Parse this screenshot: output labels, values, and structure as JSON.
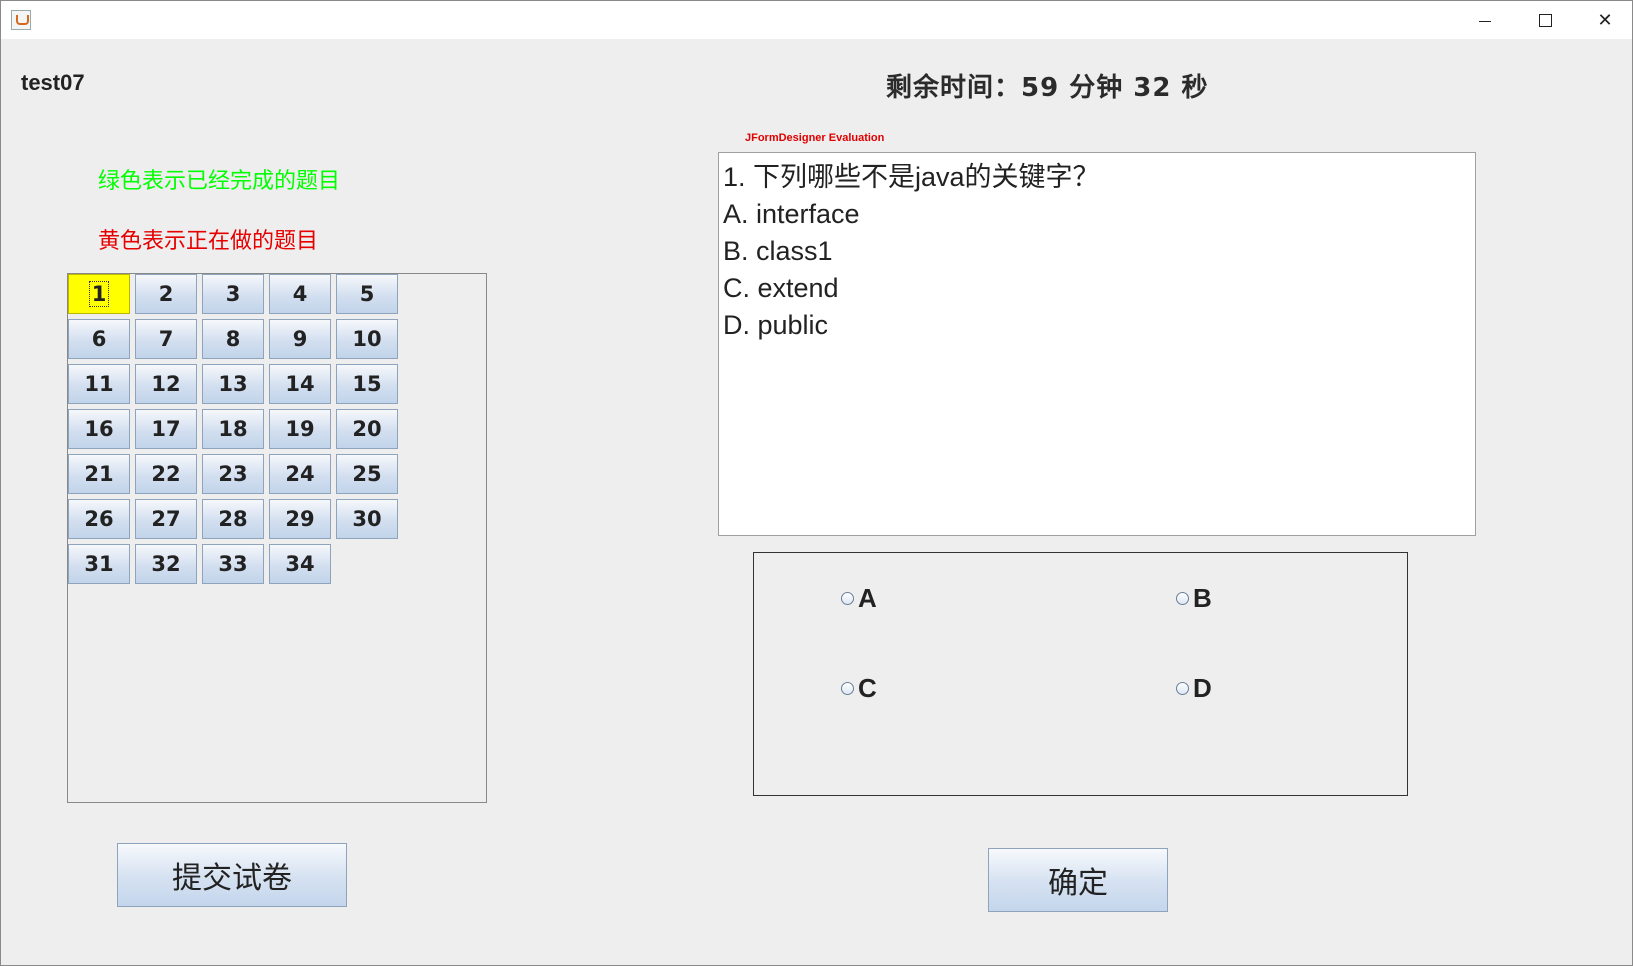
{
  "window": {
    "minimize": "—",
    "maximize": "☐",
    "close": "✕"
  },
  "user": {
    "name": "test07"
  },
  "timer": {
    "text": "剩余时间：59 分钟 32 秒"
  },
  "legend": {
    "done": "绿色表示已经完成的题目",
    "current": "黄色表示正在做的题目",
    "done_color": "#00ff00",
    "current_color": "#e60000"
  },
  "question_grid": {
    "current": "1",
    "buttons": [
      "1",
      "2",
      "3",
      "4",
      "5",
      "6",
      "7",
      "8",
      "9",
      "10",
      "11",
      "12",
      "13",
      "14",
      "15",
      "16",
      "17",
      "18",
      "19",
      "20",
      "21",
      "22",
      "23",
      "24",
      "25",
      "26",
      "27",
      "28",
      "29",
      "30",
      "31",
      "32",
      "33",
      "34"
    ]
  },
  "watermark": "JFormDesigner Evaluation",
  "question": {
    "lines": [
      "1. 下列哪些不是java的关键字？",
      "A. interface",
      "B. class1",
      "C. extend",
      "D. public"
    ]
  },
  "options": [
    "A",
    "B",
    "C",
    "D"
  ],
  "actions": {
    "submit": "提交试卷",
    "confirm": "确定"
  }
}
